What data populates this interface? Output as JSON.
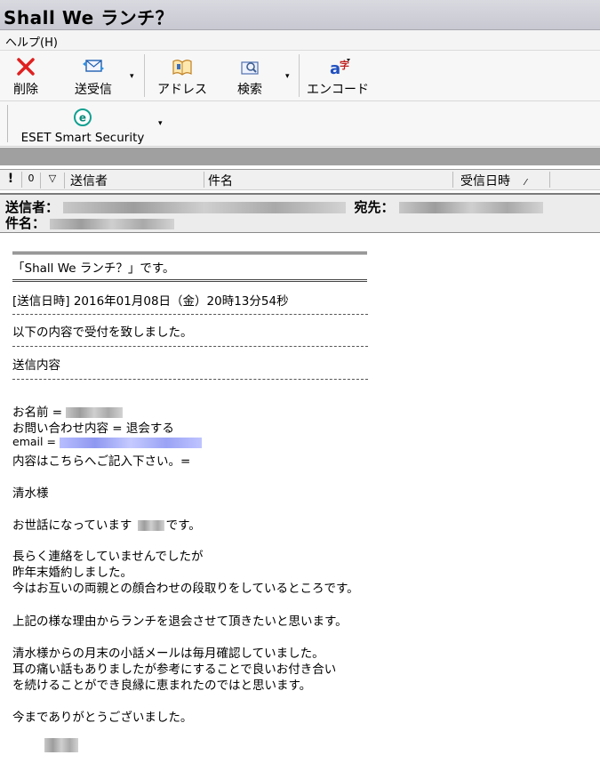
{
  "window": {
    "title": "Shall We ランチ？"
  },
  "menu": {
    "help": "ヘルプ(H)"
  },
  "toolbar": {
    "items": [
      {
        "label": "削除",
        "icon": "delete-x-icon"
      },
      {
        "label": "送受信",
        "icon": "send-receive-icon"
      },
      {
        "label": "アドレス",
        "icon": "address-book-icon"
      },
      {
        "label": "検索",
        "icon": "find-icon"
      },
      {
        "label": "エンコード",
        "icon": "encoding-icon"
      }
    ],
    "dropdown_glyph": "▾"
  },
  "toolbar2": {
    "eset_label": "ESET Smart Security",
    "eset_glyph": "e"
  },
  "list_header": {
    "priority": "!",
    "attachment": "0",
    "flag": "▽",
    "from": "送信者",
    "subject": "件名",
    "received": "受信日時",
    "sort_glyph": "⁄"
  },
  "message_header": {
    "from_label": "送信者：",
    "to_label": "宛先：",
    "subject_label": "件名："
  },
  "body": {
    "rule1": "========================================================",
    "line_title": "「Shall We ランチ？」です。",
    "rule2": "========================================================",
    "sent_line": "[送信日時] 2016年01月08日（金）20時13分54秒",
    "accepted": "以下の内容で受付を致しました。",
    "contents_label": "送信内容",
    "name_label": "お名前 =",
    "inquiry": " お問い合わせ内容 = 退会する",
    "email_label": " email =",
    "note": " 内容はこちらへご記入下さい。=",
    "salutation": "清水様",
    "greeting_a": "お世話になっています",
    "greeting_b": "です。",
    "p1": "長らく連絡をしていませんでしたが",
    "p2": "昨年末婚約しました。",
    "p3": "今はお互いの両親との顔合わせの段取りをしているところです。",
    "p4": "上記の様な理由からランチを退会させて頂きたいと思います。",
    "p5": "清水様からの月末の小話メールは毎月確認していました。",
    "p6": "耳の痛い話もありましたが参考にすることで良いお付き合い",
    "p7": "を続けることができ良縁に恵まれたのではと思います。",
    "p8": "今までありがとうございました。"
  },
  "colors": {
    "email_blur": "#9ea6f0",
    "titlebar": "#d0d0da"
  }
}
